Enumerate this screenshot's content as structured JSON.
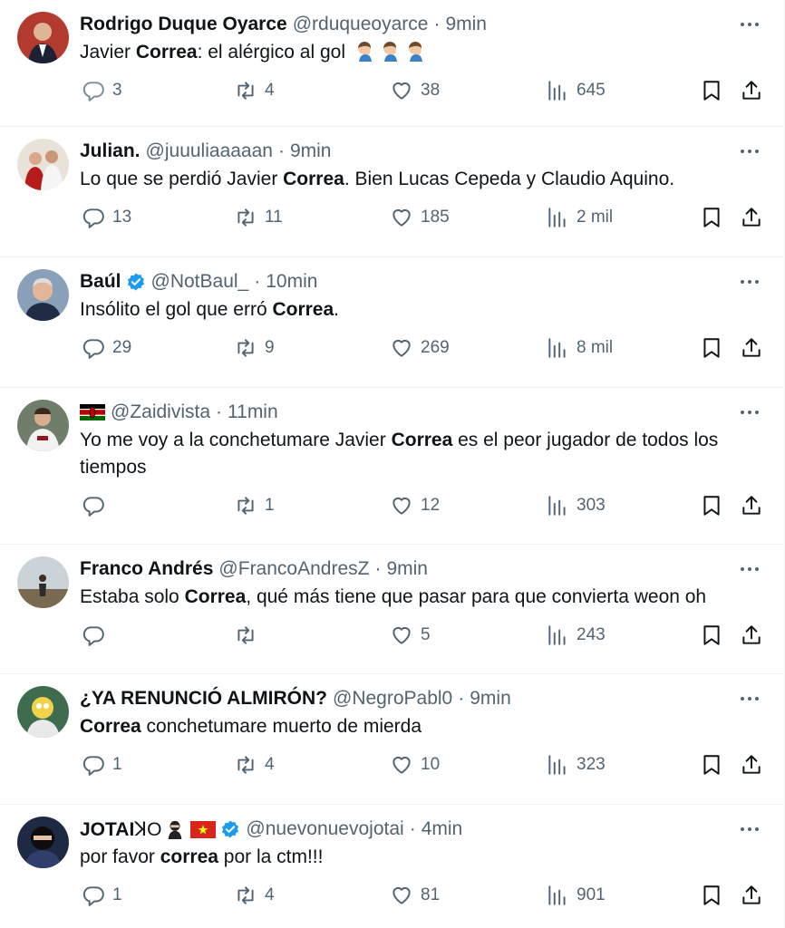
{
  "colors": {
    "text": "#0f1419",
    "secondary": "#536471",
    "divider": "#eff3f4",
    "verified": "#1d9bf0"
  },
  "tweets": [
    {
      "name": "Rodrigo Duque Oyarce",
      "handle": "@rduqueoyarce",
      "time": "9min",
      "text": [
        {
          "t": "Javier "
        },
        {
          "t": "Correa",
          "b": true
        },
        {
          "t": ": el alérgico al gol"
        }
      ],
      "emoji": "man-facepalming x3",
      "replies": "3",
      "retweets": "4",
      "likes": "38",
      "views": "645"
    },
    {
      "name": "Julian.",
      "handle": "@juuuliaaaaan",
      "time": "9min",
      "text": [
        {
          "t": "Lo que se perdió Javier "
        },
        {
          "t": "Correa",
          "b": true
        },
        {
          "t": ". Bien Lucas Cepeda y Claudio Aquino."
        }
      ],
      "replies": "13",
      "retweets": "11",
      "likes": "185",
      "views": "2 mil"
    },
    {
      "name": "Baúl",
      "handle": "@NotBaul_",
      "time": "10min",
      "verified": true,
      "text": [
        {
          "t": "Insólito el gol que erró "
        },
        {
          "t": "Correa",
          "b": true
        },
        {
          "t": "."
        }
      ],
      "replies": "29",
      "retweets": "9",
      "likes": "269",
      "views": "8 mil"
    },
    {
      "name": "",
      "handle": "@Zaidivista",
      "time": "11min",
      "flag": "kenya-flag",
      "text": [
        {
          "t": "Yo me voy a la conchetumare Javier "
        },
        {
          "t": "Correa",
          "b": true
        },
        {
          "t": " es el peor jugador de todos los tiempos"
        }
      ],
      "replies": "",
      "retweets": "1",
      "likes": "12",
      "views": "303"
    },
    {
      "name": "Franco Andrés",
      "handle": "@FrancoAndresZ",
      "time": "9min",
      "text": [
        {
          "t": "Estaba solo "
        },
        {
          "t": "Correa",
          "b": true
        },
        {
          "t": ", qué más tiene que pasar para que convierta weon oh"
        }
      ],
      "replies": "",
      "retweets": "",
      "likes": "5",
      "views": "243"
    },
    {
      "name": "¿YA RENUNCIÓ ALMIRÓN?",
      "handle": "@NegroPabl0",
      "time": "9min",
      "text": [
        {
          "t": "Correa",
          "b": true
        },
        {
          "t": " conchetumare muerto de mierda"
        }
      ],
      "replies": "1",
      "retweets": "4",
      "likes": "10",
      "views": "323"
    },
    {
      "name": "JOTAI",
      "name_suffix": "ꓘO",
      "handle": "@nuevonuevojotai",
      "time": "4min",
      "verified": true,
      "name_icons": [
        "ninja-icon",
        "vietnam-flag"
      ],
      "text": [
        {
          "t": "por favor "
        },
        {
          "t": "correa",
          "b": true
        },
        {
          "t": " por la ctm!!!"
        }
      ],
      "replies": "1",
      "retweets": "4",
      "likes": "81",
      "views": "901"
    }
  ]
}
